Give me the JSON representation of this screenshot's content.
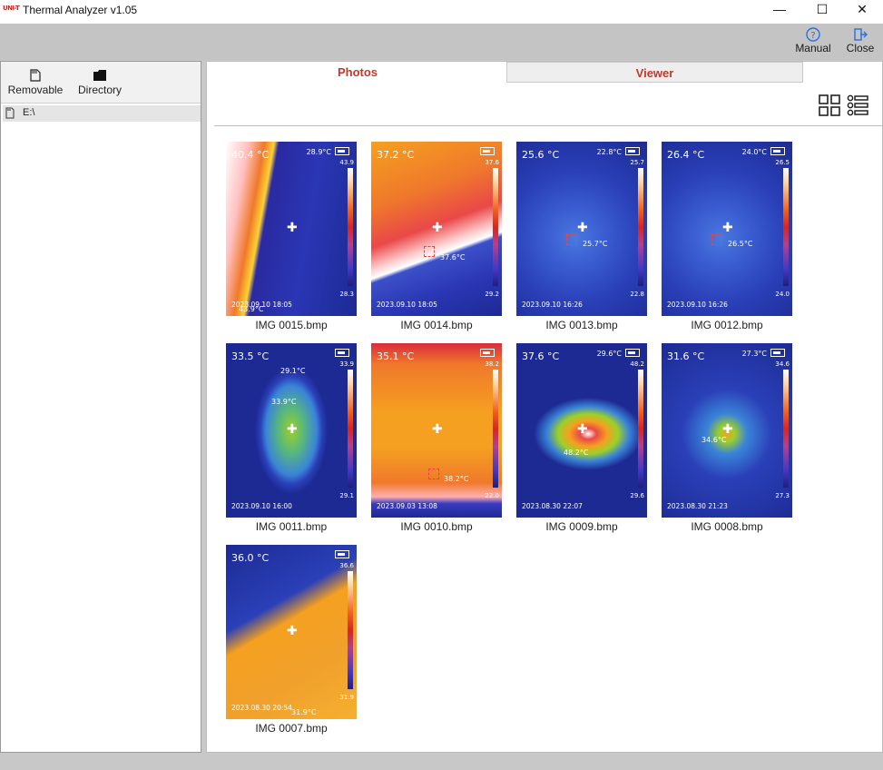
{
  "window": {
    "logo": "UNI-T",
    "title": "Thermal Analyzer v1.05",
    "min": "—",
    "max": "☐",
    "close": "✕"
  },
  "toolbar": {
    "manual_label": "Manual",
    "close_label": "Close"
  },
  "left_panel": {
    "removable_label": "Removable",
    "directory_label": "Directory",
    "drive_label": "E:\\"
  },
  "tabs": {
    "photos": "Photos",
    "viewer": "Viewer"
  },
  "photos": [
    {
      "caption": "IMG 0015.bmp",
      "temp": "40.4 °C",
      "max": "28.9°C",
      "scale_hi": "43.9",
      "scale_lo": "28.3",
      "date": "2023.09.10   18:05",
      "spot": "43.9°C"
    },
    {
      "caption": "IMG 0014.bmp",
      "temp": "37.2 °C",
      "max": "",
      "scale_hi": "37.6",
      "scale_lo": "29.2",
      "date": "2023.09.10   18:05",
      "spot": "37.6°C"
    },
    {
      "caption": "IMG 0013.bmp",
      "temp": "25.6 °C",
      "max": "22.8°C",
      "scale_hi": "25.7",
      "scale_lo": "22.8",
      "date": "2023.09.10   16:26",
      "spot": "25.7°C"
    },
    {
      "caption": "IMG 0012.bmp",
      "temp": "26.4 °C",
      "max": "24.0°C",
      "scale_hi": "26.5",
      "scale_lo": "24.0",
      "date": "2023.09.10   16:26",
      "spot": "26.5°C"
    },
    {
      "caption": "IMG 0011.bmp",
      "temp": "33.5 °C",
      "max": "29.1°C",
      "scale_hi": "33.9",
      "scale_lo": "29.1",
      "date": "2023.09.10   16:00",
      "spot": "33.9°C"
    },
    {
      "caption": "IMG 0010.bmp",
      "temp": "35.1 °C",
      "max": "",
      "scale_hi": "38.2",
      "scale_lo": "22.0",
      "date": "2023.09.03   13:08",
      "spot": "38.2°C"
    },
    {
      "caption": "IMG 0009.bmp",
      "temp": "37.6 °C",
      "max": "29.6°C",
      "scale_hi": "48.2",
      "scale_lo": "29.6",
      "date": "2023.08.30   22:07",
      "spot": "48.2°C"
    },
    {
      "caption": "IMG 0008.bmp",
      "temp": "31.6 °C",
      "max": "27.3°C",
      "scale_hi": "34.6",
      "scale_lo": "27.3",
      "date": "2023.08.30   21:23",
      "spot": "34.6°C"
    },
    {
      "caption": "IMG 0007.bmp",
      "temp": "36.0 °C",
      "max": "",
      "scale_hi": "36.6",
      "scale_lo": "31.9",
      "date": "2023.08.30   20:54",
      "spot": "31.9°C"
    }
  ]
}
